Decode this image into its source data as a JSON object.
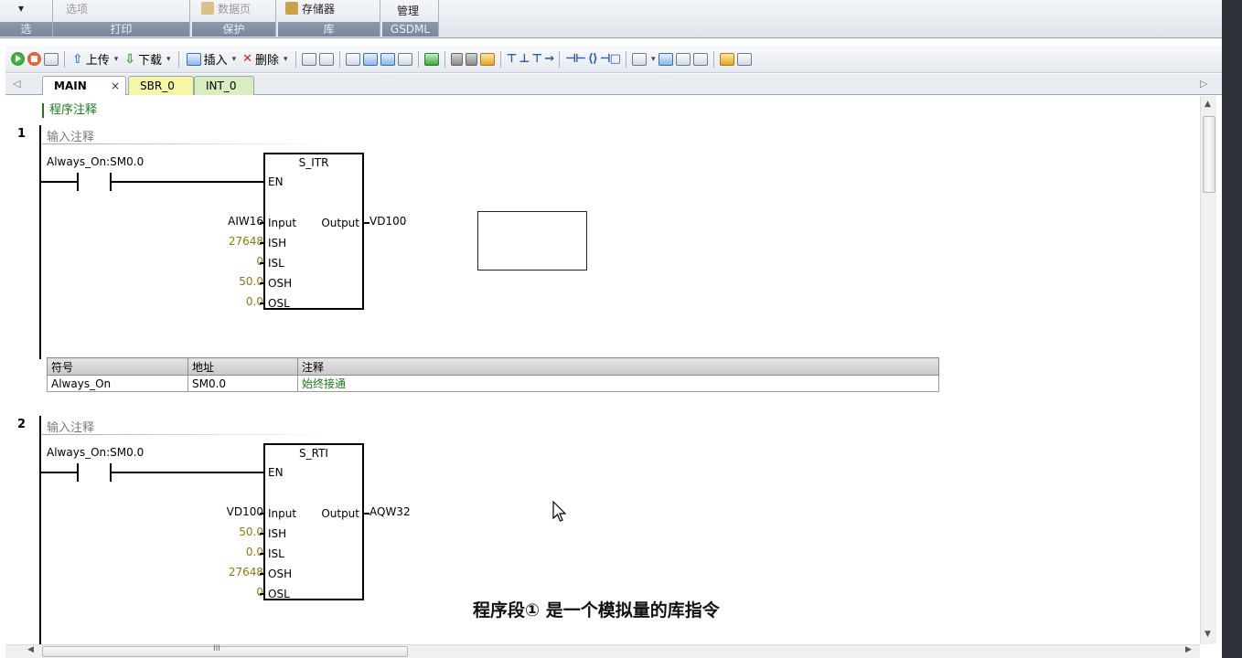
{
  "ribbon": {
    "groups": [
      {
        "label": "选",
        "button": "▾"
      },
      {
        "label": "打印",
        "button": "选项"
      },
      {
        "label": "保护",
        "button": "数据页"
      },
      {
        "label": "库",
        "button": "存储器"
      },
      {
        "label": "GSDML",
        "button": "管理"
      }
    ]
  },
  "toolbar": {
    "upload": "上传",
    "download": "下载",
    "insert": "插入",
    "delete": "删除"
  },
  "tabs": {
    "main": "MAIN",
    "main_close": "×",
    "sbr": "SBR_0",
    "int": "INT_0"
  },
  "editor": {
    "program_comment": "程序注释",
    "networks": [
      {
        "number": "1",
        "comment": "输入注释",
        "contact_label": "Always_On:SM0.0",
        "block": {
          "name": "S_ITR",
          "en": "EN",
          "inputs": [
            {
              "operand": "AIW16",
              "pin": "Input"
            },
            {
              "operand": "27648",
              "pin": "ISH"
            },
            {
              "operand": "0",
              "pin": "ISL"
            },
            {
              "operand": "50.0",
              "pin": "OSH"
            },
            {
              "operand": "0.0",
              "pin": "OSL"
            }
          ],
          "output_pin": "Output",
          "output_operand": "VD100"
        },
        "symbol_table": {
          "headers": [
            "符号",
            "地址",
            "注释"
          ],
          "rows": [
            [
              "Always_On",
              "SM0.0",
              "始终接通"
            ]
          ]
        }
      },
      {
        "number": "2",
        "comment": "输入注释",
        "contact_label": "Always_On:SM0.0",
        "block": {
          "name": "S_RTI",
          "en": "EN",
          "inputs": [
            {
              "operand": "VD100",
              "pin": "Input"
            },
            {
              "operand": "50.0",
              "pin": "ISH"
            },
            {
              "operand": "0.0",
              "pin": "ISL"
            },
            {
              "operand": "27648",
              "pin": "OSH"
            },
            {
              "operand": "0",
              "pin": "OSL"
            }
          ],
          "output_pin": "Output",
          "output_operand": "AQW32"
        }
      }
    ]
  },
  "caption": "程序段① 是一个模拟量的库指令",
  "scroll": {
    "hthumb_grip": "III"
  }
}
